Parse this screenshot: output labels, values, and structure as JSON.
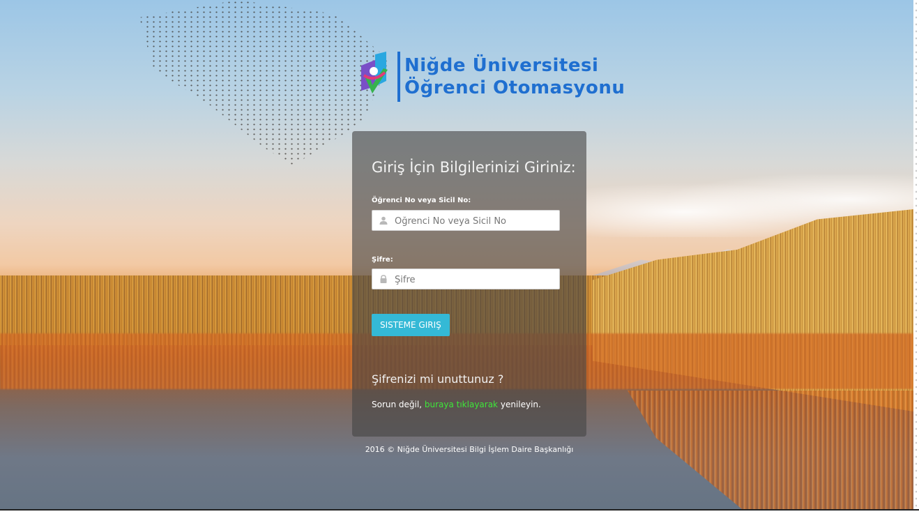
{
  "logo": {
    "line1": "Niğde Üniversitesi",
    "line2": "Öğrenci Otomasyonu"
  },
  "login": {
    "title": "Giriş İçin Bilgilerinizi Giriniz:",
    "student_label": "Öğrenci No veya Sicil No:",
    "student_placeholder": "Öğrenci No veya Sicil No",
    "student_value": "",
    "password_label": "Şifre:",
    "password_placeholder": "Şifre",
    "password_value": "",
    "submit_label": "SISTEME GIRIŞ",
    "forgot_title": "Şifrenizi mi unuttunuz ?",
    "forgot_prefix": "Sorun değil,",
    "forgot_link": "buraya tıklayarak",
    "forgot_suffix": "yenileyin."
  },
  "footer": {
    "text": "2016 © Niğde Üniversitesi Bilgi İşlem Daire Başkanlığı"
  },
  "icons": {
    "user": "user-icon",
    "lock": "lock-icon",
    "logo_mark": "university-logo-icon"
  },
  "colors": {
    "button": "#34b9d6",
    "link": "#3ee63a",
    "logo": "#1f6fd0",
    "panel": "rgba(70,70,70,0.62)"
  }
}
